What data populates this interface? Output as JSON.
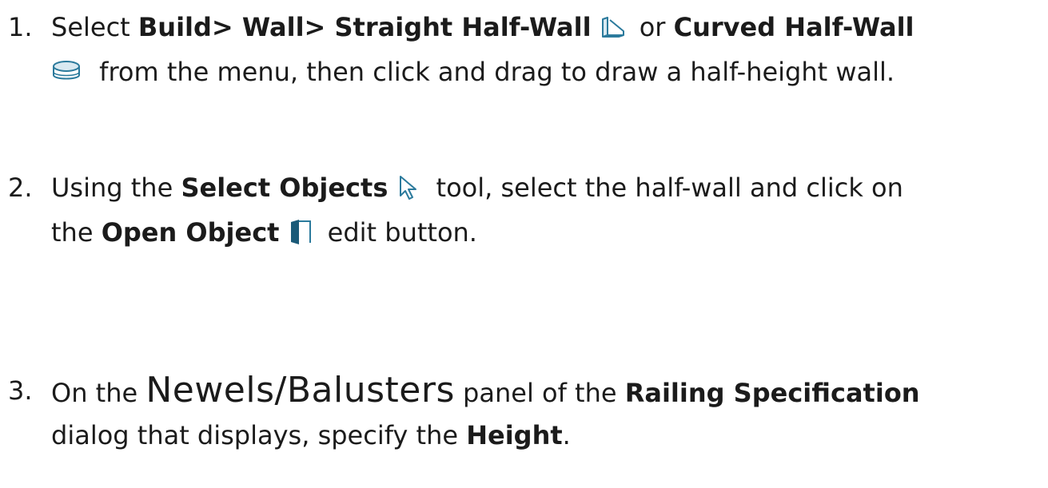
{
  "step1": {
    "number": "1.",
    "intro": "Select ",
    "menu_path": "Build> Wall> Straight Half-Wall",
    "or": " or ",
    "curved": "Curved Half-Wall",
    "line2": " from the menu, then click and drag to draw a half-height wall.",
    "icons": [
      "straight-half-wall-icon",
      "curved-half-wall-icon"
    ]
  },
  "step2": {
    "number": "2.",
    "intro": "Using the ",
    "tool": "Select Objects",
    "line1_rest": " tool, select the half-wall and click on",
    "line2_intro": "the ",
    "button": "Open Object",
    "line2_rest": " edit button.",
    "icons": [
      "select-objects-icon",
      "open-object-icon"
    ]
  },
  "step3": {
    "number": "3.",
    "intro": "On the ",
    "panel": "Newels/Balusters",
    "mid": " panel of the ",
    "dialog": "Railing Specification",
    "line2_intro": "dialog that displays, specify the ",
    "field": "Height",
    "end": "."
  },
  "colors": {
    "text": "#1b1b1b",
    "icon_blue": "#2b7a9c",
    "icon_dark": "#1a5a78",
    "icon_fill": "#d9e9f1"
  }
}
